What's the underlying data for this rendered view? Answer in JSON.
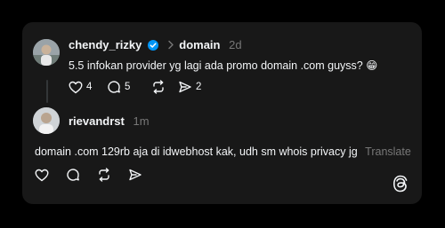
{
  "post": {
    "username": "chendy_rizky",
    "topic": "domain",
    "time": "2d",
    "text": "5.5 infokan provider yg lagi ada promo domain .com guyss? 😁",
    "likes": "4",
    "replies": "5",
    "reposts": "",
    "shares": "2"
  },
  "reply": {
    "username": "rievandrst",
    "time": "1m",
    "text": "domain .com 129rb aja di idwebhost kak, udh sm whois privacy jg",
    "translate": "Translate"
  },
  "colors": {
    "background": "#000000",
    "card": "#181818",
    "text": "#f3f5f7",
    "muted": "#777777",
    "verified": "#0095f6"
  }
}
